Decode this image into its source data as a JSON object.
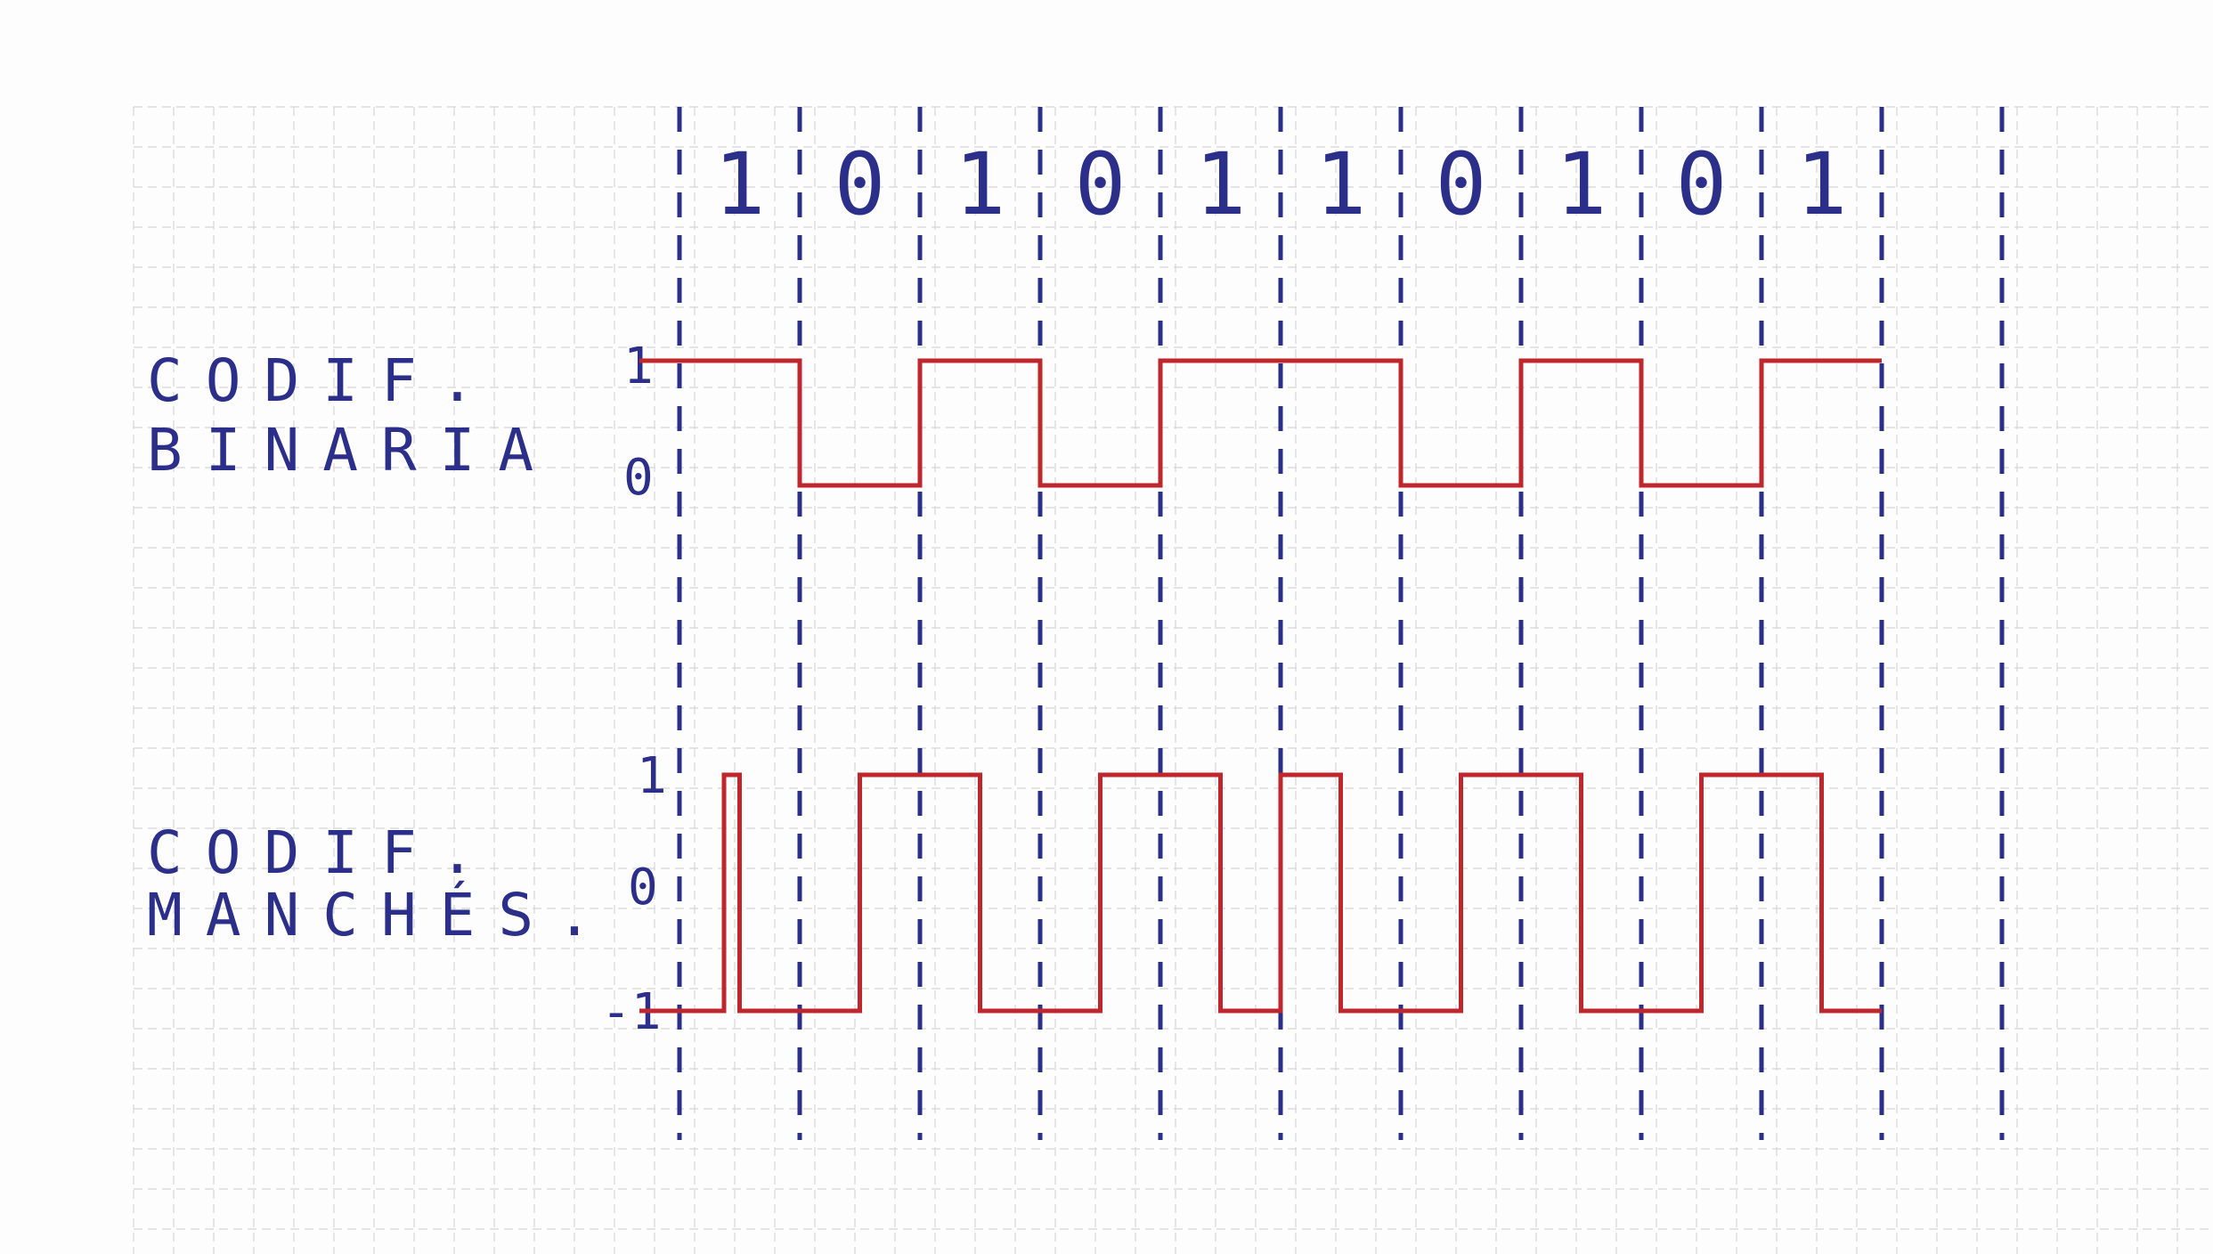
{
  "bits": [
    "1",
    "0",
    "1",
    "0",
    "1",
    "1",
    "0",
    "1",
    "0",
    "1"
  ],
  "labels": {
    "binary_line1": "CODIF.",
    "binary_line2": "BINARIA",
    "manchester_line1": "CODIF.",
    "manchester_line2": "MANCHÉS."
  },
  "levels": {
    "binary_high": "1",
    "binary_low": "0",
    "manchester_high": "1",
    "manchester_mid": "0",
    "manchester_low": "-1"
  },
  "colors": {
    "ink": "#2b2f8a",
    "signal": "#c0272d",
    "grid": "#d6d6d6"
  }
}
